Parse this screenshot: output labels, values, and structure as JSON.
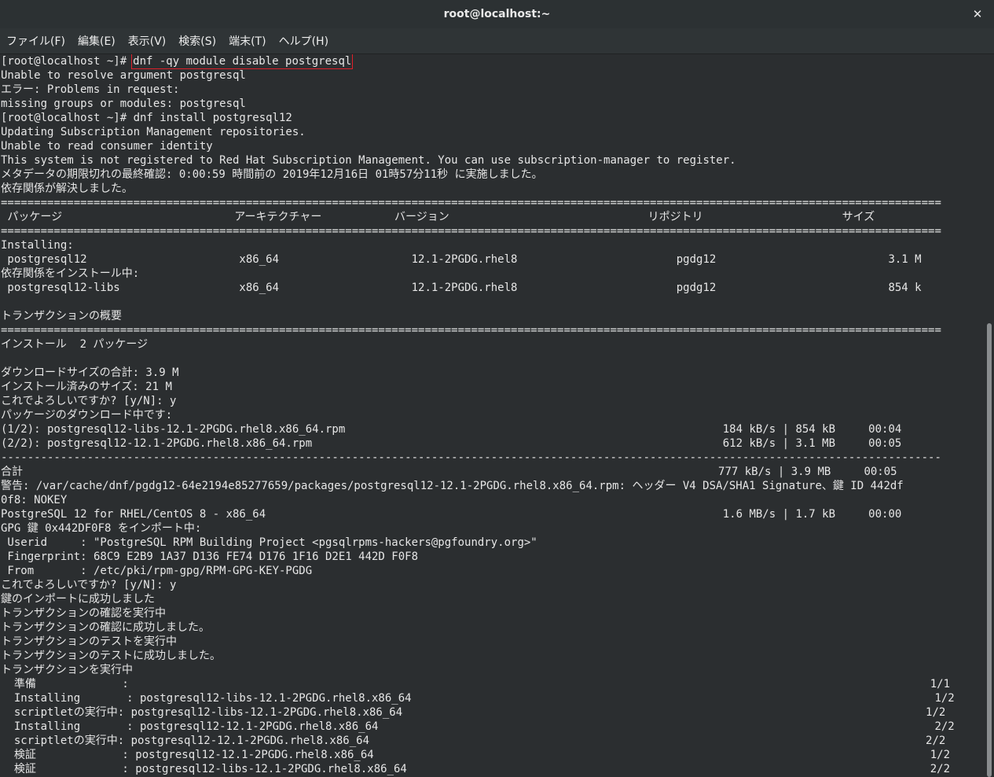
{
  "window": {
    "title": "root@localhost:~",
    "close_symbol": "✕"
  },
  "menu": {
    "file": "ファイル(F)",
    "edit": "編集(E)",
    "view": "表示(V)",
    "search": "検索(S)",
    "terminal": "端末(T)",
    "help": "ヘルプ(H)"
  },
  "terminal": {
    "prompt1": "[root@localhost ~]#",
    "command1": "dnf -qy module disable postgresql",
    "lines": [
      "Unable to resolve argument postgresql",
      "エラー: Problems in request:",
      "missing groups or modules: postgresql",
      "[root@localhost ~]# dnf install postgresql12",
      "Updating Subscription Management repositories.",
      "Unable to read consumer identity",
      "This system is not registered to Red Hat Subscription Management. You can use subscription-manager to register.",
      "メタデータの期限切れの最終確認: 0:00:59 時間前の 2019年12月16日 01時57分11秒 に実施しました。",
      "依存関係が解決しました。",
      "==============================================================================================================================================",
      " パッケージ                          アーキテクチャー           バージョン                              リポジトリ                     サイズ",
      "==============================================================================================================================================",
      "Installing:",
      " postgresql12                       x86_64                    12.1-2PGDG.rhel8                        pgdg12                          3.1 M",
      "依存関係をインストール中:",
      " postgresql12-libs                  x86_64                    12.1-2PGDG.rhel8                        pgdg12                          854 k",
      "",
      "トランザクションの概要",
      "==============================================================================================================================================",
      "インストール  2 パッケージ",
      "",
      "ダウンロードサイズの合計: 3.9 M",
      "インストール済みのサイズ: 21 M",
      "これでよろしいですか? [y/N]: y",
      "パッケージのダウンロード中です:",
      "(1/2): postgresql12-libs-12.1-2PGDG.rhel8.x86_64.rpm                                                         184 kB/s | 854 kB     00:04",
      "(2/2): postgresql12-12.1-2PGDG.rhel8.x86_64.rpm                                                              612 kB/s | 3.1 MB     00:05",
      "----------------------------------------------------------------------------------------------------------------------------------------------",
      "合計                                                                                                         777 kB/s | 3.9 MB     00:05",
      "警告: /var/cache/dnf/pgdg12-64e2194e85277659/packages/postgresql12-12.1-2PGDG.rhel8.x86_64.rpm: ヘッダー V4 DSA/SHA1 Signature、鍵 ID 442df",
      "0f8: NOKEY",
      "PostgreSQL 12 for RHEL/CentOS 8 - x86_64                                                                     1.6 MB/s | 1.7 kB     00:00",
      "GPG 鍵 0x442DF0F8 をインポート中:",
      " Userid     : \"PostgreSQL RPM Building Project <pgsqlrpms-hackers@pgfoundry.org>\"",
      " Fingerprint: 68C9 E2B9 1A37 D136 FE74 D176 1F16 D2E1 442D F0F8",
      " From       : /etc/pki/rpm-gpg/RPM-GPG-KEY-PGDG",
      "これでよろしいですか? [y/N]: y",
      "鍵のインポートに成功しました",
      "トランザクションの確認を実行中",
      "トランザクションの確認に成功しました。",
      "トランザクションのテストを実行中",
      "トランザクションのテストに成功しました。",
      "トランザクションを実行中",
      "  準備             :                                                                                                                         1/1",
      "  Installing       : postgresql12-libs-12.1-2PGDG.rhel8.x86_64                                                                               1/2",
      "  scriptletの実行中: postgresql12-libs-12.1-2PGDG.rhel8.x86_64                                                                               1/2",
      "  Installing       : postgresql12-12.1-2PGDG.rhel8.x86_64                                                                                    2/2",
      "  scriptletの実行中: postgresql12-12.1-2PGDG.rhel8.x86_64                                                                                    2/2",
      "  検証             : postgresql12-12.1-2PGDG.rhel8.x86_64                                                                                    1/2",
      "  検証             : postgresql12-libs-12.1-2PGDG.rhel8.x86_64                                                                               2/2"
    ]
  }
}
